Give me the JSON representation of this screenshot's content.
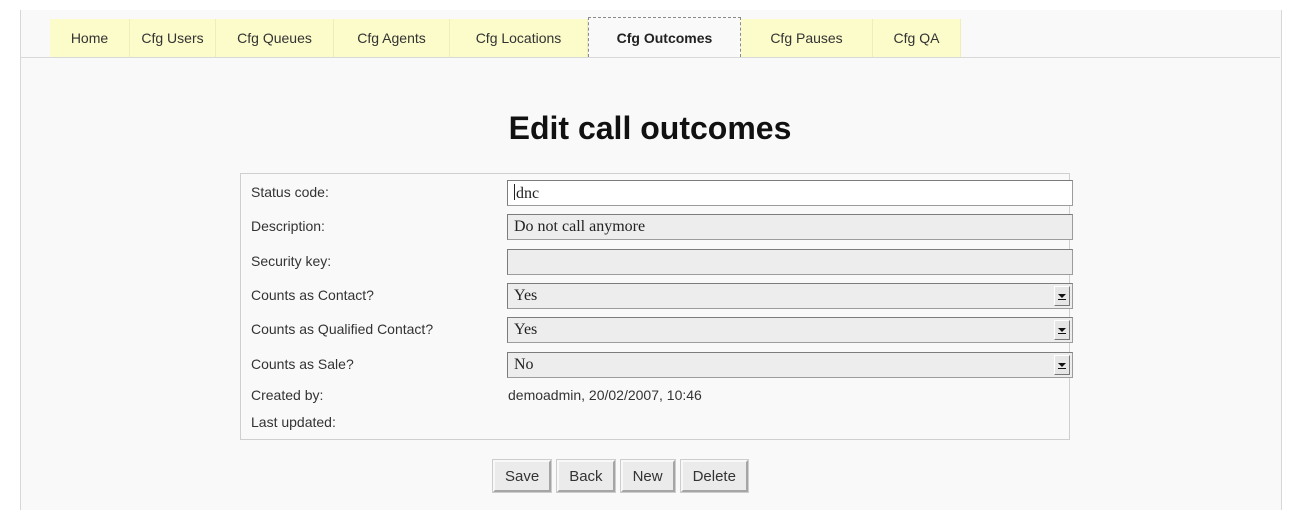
{
  "tabs": [
    {
      "label": "Home",
      "active": false
    },
    {
      "label": "Cfg Users",
      "active": false
    },
    {
      "label": "Cfg Queues",
      "active": false
    },
    {
      "label": "Cfg Agents",
      "active": false
    },
    {
      "label": "Cfg Locations",
      "active": false
    },
    {
      "label": "Cfg Outcomes",
      "active": true
    },
    {
      "label": "Cfg Pauses",
      "active": false
    },
    {
      "label": "Cfg QA",
      "active": false
    }
  ],
  "page": {
    "title": "Edit call outcomes"
  },
  "form": {
    "status_code": {
      "label": "Status code:",
      "value": "dnc"
    },
    "description": {
      "label": "Description:",
      "value": "Do not call anymore"
    },
    "security_key": {
      "label": "Security key:",
      "value": ""
    },
    "counts_contact": {
      "label": "Counts as Contact?",
      "value": "Yes"
    },
    "counts_qualified": {
      "label": "Counts as Qualified Contact?",
      "value": "Yes"
    },
    "counts_sale": {
      "label": "Counts as Sale?",
      "value": "No"
    },
    "created_by": {
      "label": "Created by:",
      "value": "demoadmin, 20/02/2007, 10:46"
    },
    "last_updated": {
      "label": "Last updated:",
      "value": ""
    }
  },
  "buttons": {
    "save": "Save",
    "back": "Back",
    "new": "New",
    "delete": "Delete"
  },
  "icons": {
    "select_arrow": "chevron-down-icon"
  }
}
